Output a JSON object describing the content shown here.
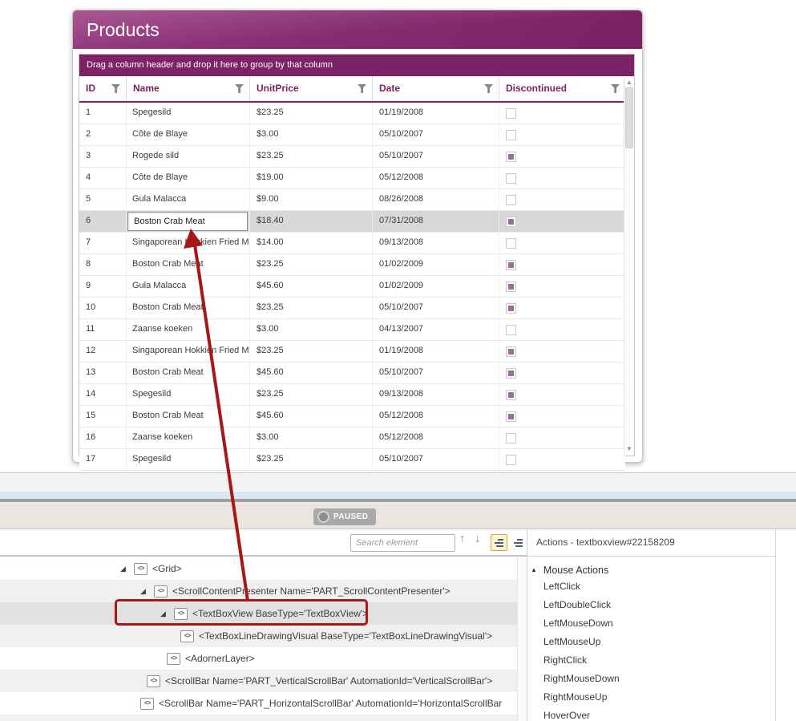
{
  "window": {
    "title": "Products"
  },
  "grid": {
    "group_hint": "Drag a column header and drop it here to group by that column",
    "columns": [
      "ID",
      "Name",
      "UnitPrice",
      "Date",
      "Discontinued"
    ],
    "rows": [
      {
        "id": "1",
        "name": "Spegesild",
        "unit_price": "$23.25",
        "date": "01/19/2008",
        "discontinued": false
      },
      {
        "id": "2",
        "name": "Côte de Blaye",
        "unit_price": "$3.00",
        "date": "05/10/2007",
        "discontinued": false
      },
      {
        "id": "3",
        "name": "Rogede sild",
        "unit_price": "$23.25",
        "date": "05/10/2007",
        "discontinued": true
      },
      {
        "id": "4",
        "name": "Côte de Blaye",
        "unit_price": "$19.00",
        "date": "05/12/2008",
        "discontinued": false
      },
      {
        "id": "5",
        "name": "Gula Malacca",
        "unit_price": "$9.00",
        "date": "08/26/2008",
        "discontinued": false
      },
      {
        "id": "6",
        "name": "Boston Crab Meat",
        "unit_price": "$18.40",
        "date": "07/31/2008",
        "discontinued": true,
        "selected": true,
        "editing": true
      },
      {
        "id": "7",
        "name": "Singaporean Hokkien Fried Mee",
        "unit_price": "$14.00",
        "date": "09/13/2008",
        "discontinued": false
      },
      {
        "id": "8",
        "name": "Boston Crab Meat",
        "unit_price": "$23.25",
        "date": "01/02/2009",
        "discontinued": true
      },
      {
        "id": "9",
        "name": "Gula Malacca",
        "unit_price": "$45.60",
        "date": "01/02/2009",
        "discontinued": true
      },
      {
        "id": "10",
        "name": "Boston Crab Meat",
        "unit_price": "$23.25",
        "date": "05/10/2007",
        "discontinued": true
      },
      {
        "id": "11",
        "name": "Zaanse koeken",
        "unit_price": "$3.00",
        "date": "04/13/2007",
        "discontinued": false
      },
      {
        "id": "12",
        "name": "Singaporean Hokkien Fried Mee",
        "unit_price": "$23.25",
        "date": "01/19/2008",
        "discontinued": true
      },
      {
        "id": "13",
        "name": "Boston Crab Meat",
        "unit_price": "$45.60",
        "date": "05/10/2007",
        "discontinued": true
      },
      {
        "id": "14",
        "name": "Spegesild",
        "unit_price": "$23.25",
        "date": "09/13/2008",
        "discontinued": true
      },
      {
        "id": "15",
        "name": "Boston Crab Meat",
        "unit_price": "$45.60",
        "date": "05/12/2008",
        "discontinued": true
      },
      {
        "id": "16",
        "name": "Zaanse koeken",
        "unit_price": "$3.00",
        "date": "05/12/2008",
        "discontinued": false
      },
      {
        "id": "17",
        "name": "Spegesild",
        "unit_price": "$23.25",
        "date": "05/10/2007",
        "discontinued": false
      }
    ]
  },
  "status": {
    "paused_label": "PAUSED"
  },
  "inspector": {
    "search_placeholder": "Search element",
    "tree": [
      {
        "label": "<Grid>",
        "expander": true,
        "indent": 150
      },
      {
        "label": "<ScrollContentPresenter Name='PART_ScrollContentPresenter'>",
        "expander": true,
        "indent": 175
      },
      {
        "label": "<TextBoxView BaseType='TextBoxView'>",
        "expander": true,
        "indent": 200,
        "selected": true
      },
      {
        "label": "<TextBoxLineDrawingVisual BaseType='TextBoxLineDrawingVisual'>",
        "expander": false,
        "indent": 225
      },
      {
        "label": "<AdornerLayer>",
        "expander": false,
        "indent": 208
      },
      {
        "label": "<ScrollBar Name='PART_VerticalScrollBar' AutomationId='VerticalScrollBar'>",
        "expander": false,
        "indent": 183
      },
      {
        "label": "<ScrollBar Name='PART_HorizontalScrollBar' AutomationId='HorizontalScrollBar",
        "expander": false,
        "indent": 175
      }
    ]
  },
  "actions": {
    "title": "Actions - textboxview#22158209",
    "group_label": "Mouse Actions",
    "items": [
      "LeftClick",
      "LeftDoubleClick",
      "LeftMouseDown",
      "LeftMouseUp",
      "RightClick",
      "RightMouseDown",
      "RightMouseUp",
      "HoverOver"
    ]
  },
  "colors": {
    "accent_purple": "#7d2266",
    "annotation_red": "#a81616",
    "selected_row_gray": "#d8d8d8",
    "checkbox_checked": "#9e6b96",
    "toggle_highlight": "#dfa728"
  }
}
